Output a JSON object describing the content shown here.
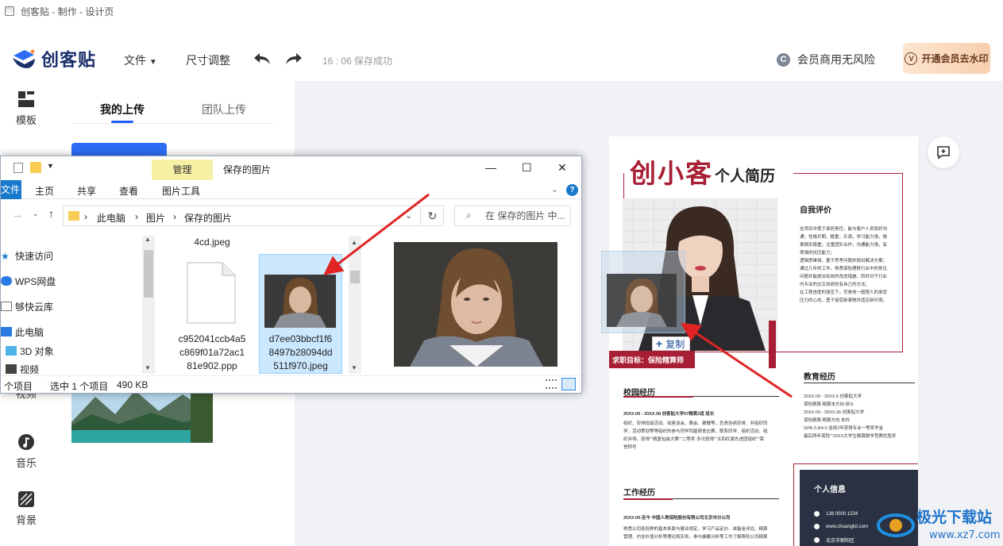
{
  "window": {
    "title": "创客贴 - 制作 - 设计页"
  },
  "header": {
    "logo_text": "创客贴",
    "file_menu": "文件",
    "resize": "尺寸调整",
    "save_status": "16 : 06 保存成功",
    "commerce": "会员商用无风险",
    "vip_button": "开通会员去水印",
    "accent_color": "#1f5cf6"
  },
  "rail": {
    "items": [
      {
        "label": "模板",
        "icon": "template-icon"
      },
      {
        "label": "视频",
        "icon": "video-icon"
      },
      {
        "label": "音乐",
        "icon": "music-icon"
      },
      {
        "label": "背景",
        "icon": "background-icon"
      }
    ]
  },
  "panel": {
    "tabs": [
      "我的上传",
      "团队上传"
    ],
    "active_tab": 0
  },
  "explorer": {
    "manage_tab": "管理",
    "title": "保存的图片",
    "ribbon": [
      "文件",
      "主页",
      "共享",
      "查看",
      "图片工具"
    ],
    "breadcrumb": [
      "此电脑",
      "图片",
      "保存的图片"
    ],
    "search_placeholder": "在 保存的图片 中...",
    "nav": [
      "快速访问",
      "WPS网盘",
      "够快云库",
      "此电脑",
      "3D 对象",
      "视频"
    ],
    "files": [
      {
        "top_label": "4cd.jpeg"
      },
      {
        "name": "c952041ccb4a5c869f01a72ac181e902.ppp",
        "lines": [
          "c952041ccb4a5",
          "c869f01a72ac1",
          "81e902.ppp"
        ]
      },
      {
        "name": "d7ee03bbcf1f68497b28094dd511f970.jpeg",
        "lines": [
          "d7ee03bbcf1f6",
          "8497b28094dd",
          "511f970.jpeg"
        ],
        "selected": true
      }
    ],
    "status_items": "个项目",
    "status_selected": "选中 1 个项目",
    "status_size": "490 KB"
  },
  "drag": {
    "copy_label": "复制"
  },
  "resume": {
    "name": "创小客",
    "subtitle": "个人简历",
    "self_eval_title": "自我评价",
    "self_eval_lines": [
      "在项目中勇于承担责任，能与客户人员良好沟",
      "通；性格开朗、稳重，乐观，学习能力强，愉",
      "事情实稳重；注重团队合作，沟通能力强，有",
      "很强的抗压能力；",
      "逻辑思维强，善于思考问题并提出解决方案；",
      "通过几年的工作，熟悉保险理财行业中的常见",
      "问题并能提出有效的改进措施，同时对于行业",
      "内专业的交叉协调也有自己的方法；",
      "在工程进度的强压下，尽责地一般程人的承受",
      "压力的心态，勇于接受新事物并适应新环境。"
    ],
    "goal": "求职目标：保险精算师",
    "campus_title": "校园经历",
    "campus_head": "20XX.09 - 20XX.08   创客贴大学07精算2班   班长",
    "campus_lines": [
      "组织、安排班级活动，如座谈会、晚会、聚餐等，负责协商安排、并组织同",
      "学、活动策划等等组织的参与同学同屋宿舍比赛，联系同学、组织活动、组",
      "织并得，获得\"\"晴篮包级大赛\"\"二等奖·多次获得\"\"五四红旗先进团组织\"\"荣",
      "誉称号"
    ],
    "edu_title": "教育经历",
    "edu_lines": [
      "20XX.09 - 20XX.6   创客贴大学",
      "保险精算  精算本方向 硕士",
      "20XX.09 - 20XX.06   创客贴大学",
      "保险精算  精算方向 本科",
      "GPA:3.9/4.0 连续2年获得专业一等奖学金",
      "最后两年保险\"\"20XX大学生精算数学竞赛优胜奖"
    ],
    "work_title": "工作经历",
    "work_head": "20XX.09-至今  中国人寿保险股份有限公司北京市分公司",
    "work_lines": [
      "熟悉公司各险种的基本条款与展业规定，学习产品定价、准备金评估、精算",
      "管理、内含价值分析等理论和实务，参与编纂分析等工作了解寿险公司精算"
    ],
    "info_title": "个人信息",
    "info_items": [
      "138 0000 1234",
      "www.chuangkit.com",
      "北京市朝阳区"
    ]
  },
  "watermark": {
    "text": "极光下载站",
    "url": "www.xz7.com"
  }
}
